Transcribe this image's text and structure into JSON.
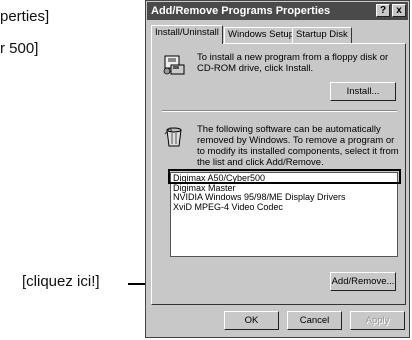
{
  "doc": {
    "fragment_top": "perties]",
    "fragment_mid": "r 500]",
    "callout_label": "[cliquez ici!]"
  },
  "dialog": {
    "title": "Add/Remove Programs Properties",
    "help_label": "?",
    "close_label": "x",
    "tabs": [
      {
        "label": "Install/Uninstall"
      },
      {
        "label": "Windows Setup"
      },
      {
        "label": "Startup Disk"
      }
    ],
    "install_text": "To install a new program from a floppy disk or CD-ROM drive, click Install.",
    "install_button": "Install...",
    "remove_text": "The following software can be automatically removed by Windows. To remove a program or to modify its installed components, select it from the list and click Add/Remove.",
    "programs": [
      "Digimax A50/Cyber500",
      "Digimax Master",
      "NVIDIA Windows 95/98/ME Display Drivers",
      "XviD MPEG-4 Video Codec"
    ],
    "add_remove_button": "Add/Remove...",
    "ok_button": "OK",
    "cancel_button": "Cancel",
    "apply_button": "Apply"
  }
}
